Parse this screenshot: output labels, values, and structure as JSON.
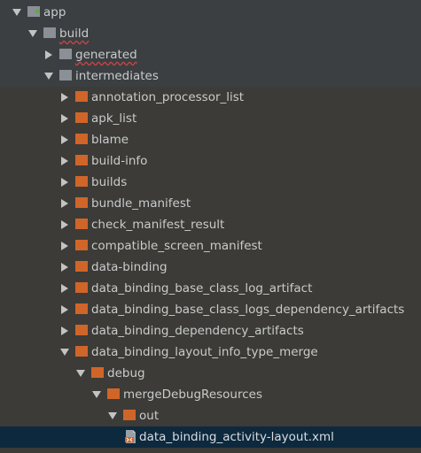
{
  "tree": {
    "nodes": [
      {
        "label": "app",
        "depth": 0,
        "state": "expanded",
        "icon": "module-folder-icon",
        "color": "grey"
      },
      {
        "label": "build",
        "depth": 1,
        "state": "expanded",
        "icon": "folder-icon",
        "color": "grey"
      },
      {
        "label": "generated",
        "depth": 2,
        "state": "collapsed",
        "icon": "folder-icon",
        "color": "grey"
      },
      {
        "label": "intermediates",
        "depth": 2,
        "state": "expanded",
        "icon": "folder-icon",
        "color": "grey"
      },
      {
        "label": "annotation_processor_list",
        "depth": 3,
        "state": "collapsed",
        "icon": "folder-icon",
        "color": "orange"
      },
      {
        "label": "apk_list",
        "depth": 3,
        "state": "collapsed",
        "icon": "folder-icon",
        "color": "orange"
      },
      {
        "label": "blame",
        "depth": 3,
        "state": "collapsed",
        "icon": "folder-icon",
        "color": "orange"
      },
      {
        "label": "build-info",
        "depth": 3,
        "state": "collapsed",
        "icon": "folder-icon",
        "color": "orange"
      },
      {
        "label": "builds",
        "depth": 3,
        "state": "collapsed",
        "icon": "folder-icon",
        "color": "orange"
      },
      {
        "label": "bundle_manifest",
        "depth": 3,
        "state": "collapsed",
        "icon": "folder-icon",
        "color": "orange"
      },
      {
        "label": "check_manifest_result",
        "depth": 3,
        "state": "collapsed",
        "icon": "folder-icon",
        "color": "orange"
      },
      {
        "label": "compatible_screen_manifest",
        "depth": 3,
        "state": "collapsed",
        "icon": "folder-icon",
        "color": "orange"
      },
      {
        "label": "data-binding",
        "depth": 3,
        "state": "collapsed",
        "icon": "folder-icon",
        "color": "orange"
      },
      {
        "label": "data_binding_base_class_log_artifact",
        "depth": 3,
        "state": "collapsed",
        "icon": "folder-icon",
        "color": "orange"
      },
      {
        "label": "data_binding_base_class_logs_dependency_artifacts",
        "depth": 3,
        "state": "collapsed",
        "icon": "folder-icon",
        "color": "orange"
      },
      {
        "label": "data_binding_dependency_artifacts",
        "depth": 3,
        "state": "collapsed",
        "icon": "folder-icon",
        "color": "orange"
      },
      {
        "label": "data_binding_layout_info_type_merge",
        "depth": 3,
        "state": "expanded",
        "icon": "folder-icon",
        "color": "orange"
      },
      {
        "label": "debug",
        "depth": 4,
        "state": "expanded",
        "icon": "folder-icon",
        "color": "orange"
      },
      {
        "label": "mergeDebugResources",
        "depth": 5,
        "state": "expanded",
        "icon": "folder-icon",
        "color": "orange"
      },
      {
        "label": "out",
        "depth": 6,
        "state": "expanded",
        "icon": "folder-icon",
        "color": "orange"
      },
      {
        "label": "data_binding_activity-layout.xml",
        "depth": 7,
        "state": "leaf",
        "icon": "xml-file-icon",
        "color": "orange",
        "selected": true
      }
    ]
  },
  "colors": {
    "header_bg": "#3b3f41",
    "body_bg": "#3c3b37",
    "selection_bg": "#0d293e",
    "text": "#c9cbcc",
    "folder_grey": "#8a9095",
    "folder_orange": "#d0652a"
  }
}
